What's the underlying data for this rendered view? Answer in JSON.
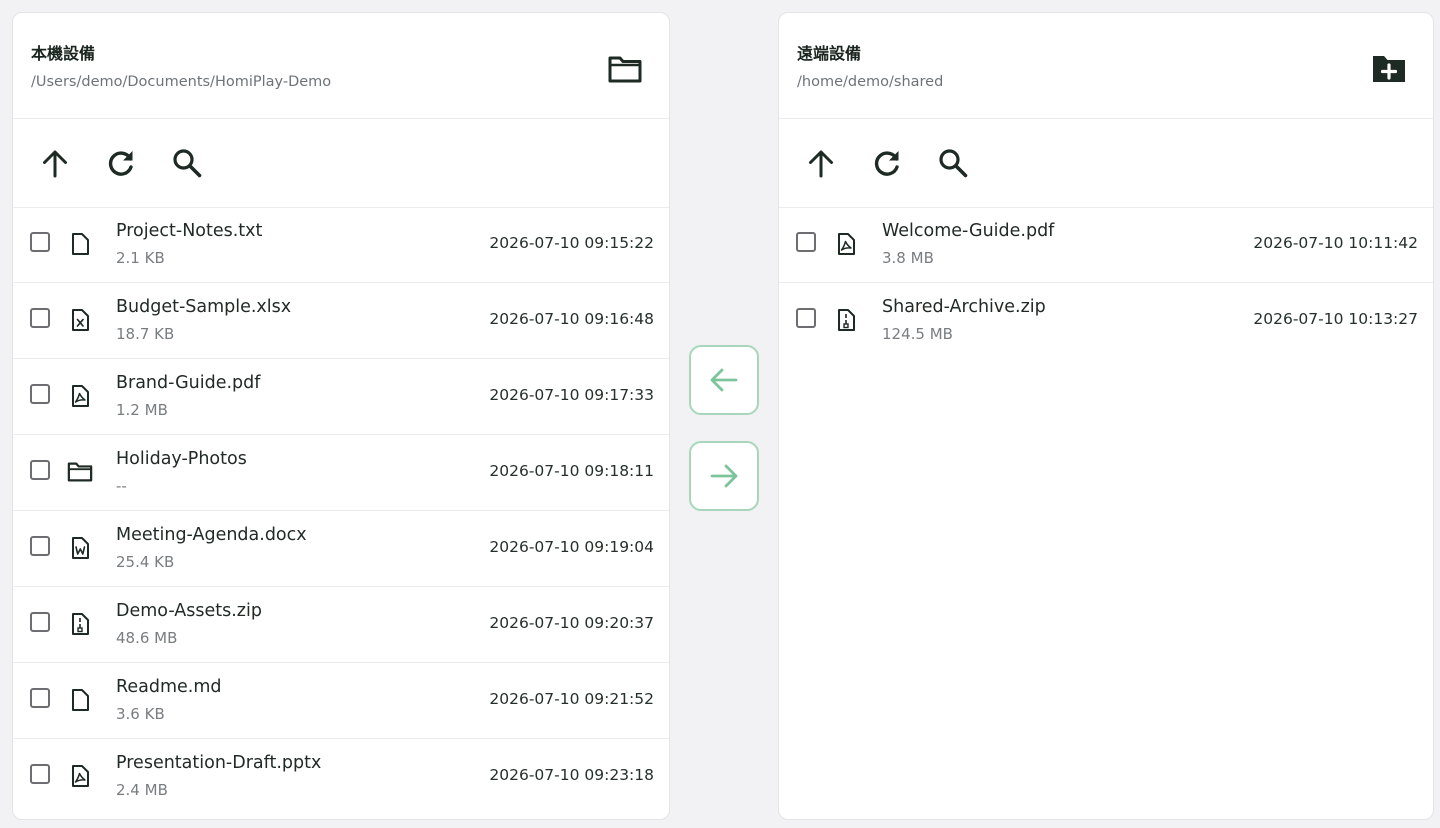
{
  "local": {
    "title": "本機設備",
    "path": "/Users/demo/Documents/HomiPlay-Demo",
    "header_action_icon": "folder-open-icon",
    "toolbar": [
      "arrow-up-icon",
      "refresh-icon",
      "search-icon"
    ],
    "files": [
      {
        "name": "Project-Notes.txt",
        "size": "2.1 KB",
        "modified": "2026-07-10 09:15:22",
        "icon": "file-icon"
      },
      {
        "name": "Budget-Sample.xlsx",
        "size": "18.7 KB",
        "modified": "2026-07-10 09:16:48",
        "icon": "excel-file-icon"
      },
      {
        "name": "Brand-Guide.pdf",
        "size": "1.2 MB",
        "modified": "2026-07-10 09:17:33",
        "icon": "pdf-file-icon"
      },
      {
        "name": "Holiday-Photos",
        "size": "--",
        "modified": "2026-07-10 09:18:11",
        "icon": "folder-icon"
      },
      {
        "name": "Meeting-Agenda.docx",
        "size": "25.4 KB",
        "modified": "2026-07-10 09:19:04",
        "icon": "word-file-icon"
      },
      {
        "name": "Demo-Assets.zip",
        "size": "48.6 MB",
        "modified": "2026-07-10 09:20:37",
        "icon": "zip-file-icon"
      },
      {
        "name": "Readme.md",
        "size": "3.6 KB",
        "modified": "2026-07-10 09:21:52",
        "icon": "file-icon"
      },
      {
        "name": "Presentation-Draft.pptx",
        "size": "2.4 MB",
        "modified": "2026-07-10 09:23:18",
        "icon": "pdf-file-icon"
      }
    ]
  },
  "remote": {
    "title": "遠端設備",
    "path": "/home/demo/shared",
    "header_action_icon": "new-folder-icon",
    "toolbar": [
      "arrow-up-icon",
      "refresh-icon",
      "search-icon"
    ],
    "files": [
      {
        "name": "Welcome-Guide.pdf",
        "size": "3.8 MB",
        "modified": "2026-07-10 10:11:42",
        "icon": "pdf-file-icon"
      },
      {
        "name": "Shared-Archive.zip",
        "size": "124.5 MB",
        "modified": "2026-07-10 10:13:27",
        "icon": "zip-file-icon"
      }
    ]
  },
  "transfer": {
    "to_local_icon": "arrow-left-icon",
    "to_remote_icon": "arrow-right-icon"
  },
  "colors": {
    "accent": "#7cc49b",
    "accent_border": "#a8d6bb",
    "icon_dark": "#1e2a24",
    "background": "#f2f2f4"
  }
}
